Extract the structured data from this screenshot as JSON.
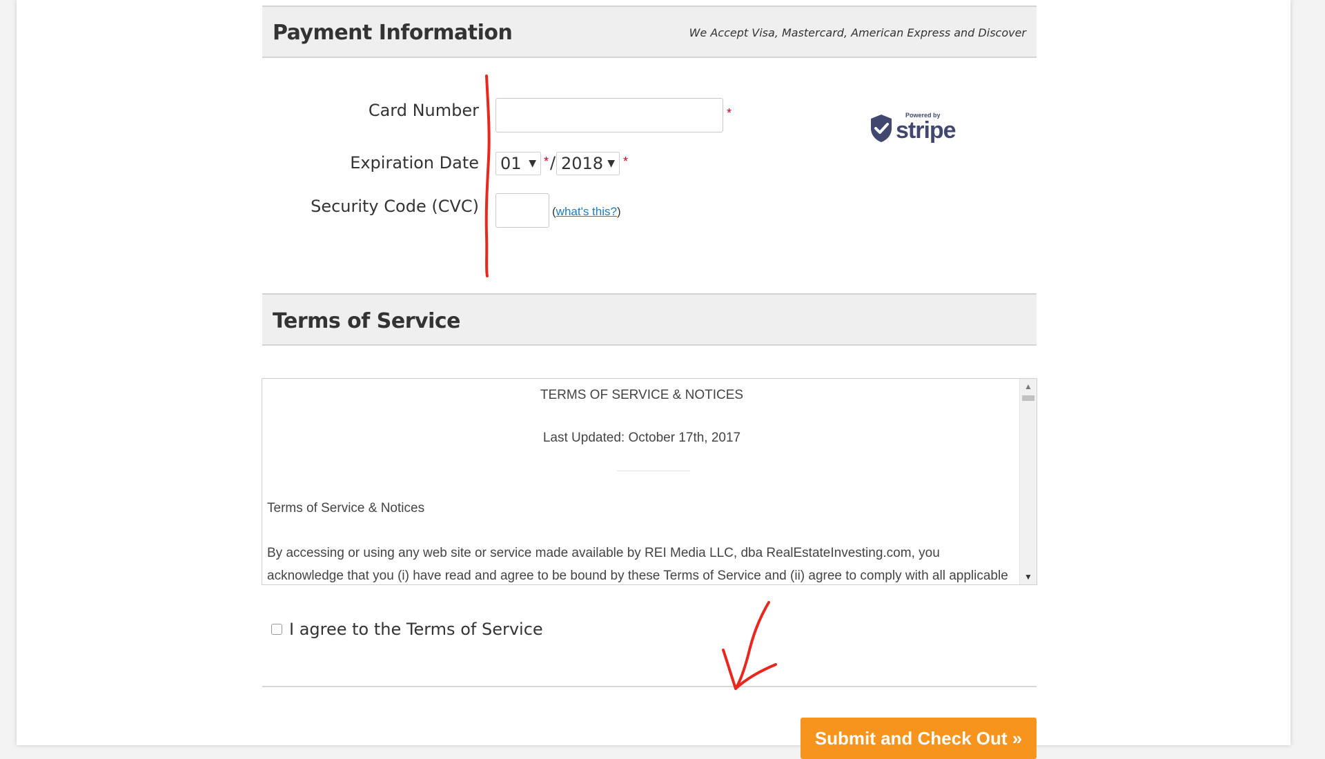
{
  "payment": {
    "title": "Payment Information",
    "accept_note": "We Accept Visa, Mastercard, American Express and Discover",
    "card_number_label": "Card Number",
    "card_number_value": "",
    "expiration_label": "Expiration Date",
    "exp_month": "01",
    "exp_separator": "/",
    "exp_year": "2018",
    "cvc_label": "Security Code (CVC)",
    "cvc_value": "",
    "whats_this_link": "what's this?",
    "required_marker": "*",
    "stripe_powered": "Powered by",
    "stripe_wordmark": "stripe"
  },
  "terms": {
    "title": "Terms of Service",
    "doc_heading": "TERMS OF SERVICE & NOTICES",
    "last_updated": "Last Updated: October 17th, 2017",
    "subheading": "Terms of Service & Notices",
    "paragraph": "By accessing or using any web site or service made available by REI Media LLC, dba RealEstateInvesting.com, you acknowledge that you (i) have read and agree to be bound by these Terms of Service and (ii) agree to comply with all applicable laws and",
    "agree_label": "I agree to the Terms of Service",
    "agree_checked": false
  },
  "submit_label": "Submit and Check Out »",
  "colors": {
    "accent": "#f7941d",
    "link": "#1a7cc0",
    "required": "#d0021b",
    "annotation": "#e8281e",
    "stripe": "#424770"
  }
}
